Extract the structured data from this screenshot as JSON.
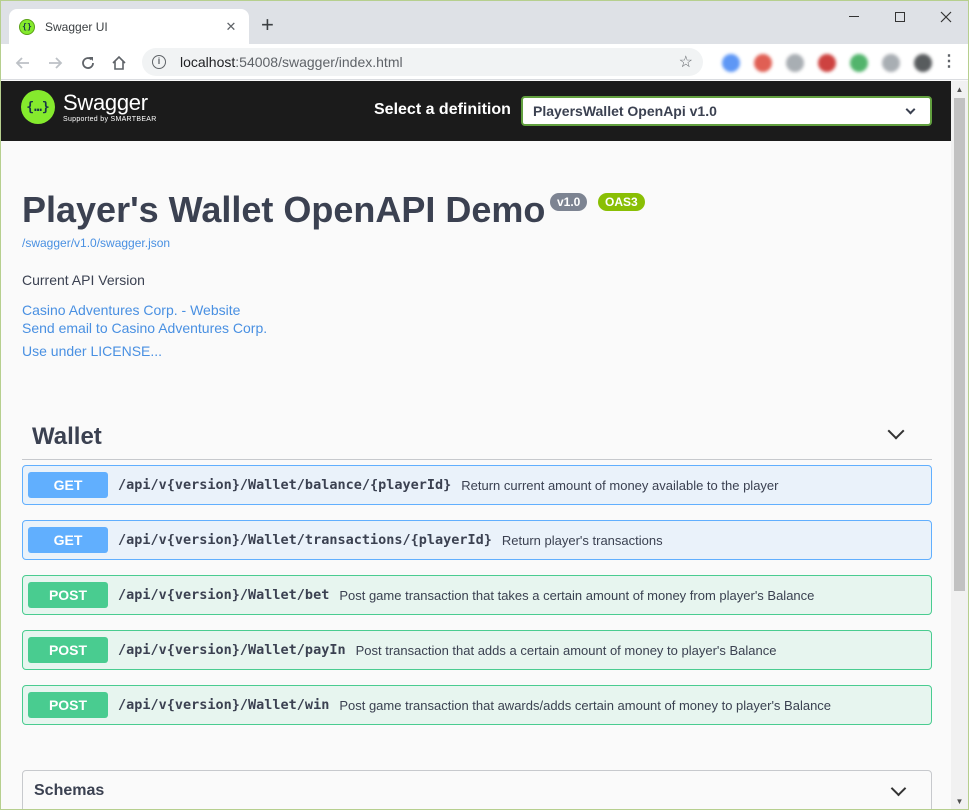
{
  "browser": {
    "tab_title": "Swagger UI",
    "tab_close": "✕",
    "new_tab": "+",
    "url_host": "localhost",
    "url_rest": ":54008/swagger/index.html",
    "extensions": [
      "#4285f4",
      "#db4437",
      "#9aa0a6",
      "#c5221f",
      "#34a853",
      "#9aa0a6",
      "#3c4043"
    ]
  },
  "swagger": {
    "brand": "Swagger",
    "brand_sub": "Supported by SMARTBEAR",
    "logo_glyph": "{…}",
    "definition_label": "Select a definition",
    "definition_value": "PlayersWallet OpenApi v1.0"
  },
  "info": {
    "title": "Player's Wallet OpenAPI Demo",
    "version_badge": "v1.0",
    "oas_badge": "OAS3",
    "spec_url": "/swagger/v1.0/swagger.json",
    "description": "Current API Version",
    "website_link": "Casino Adventures Corp. - Website",
    "email_link": "Send email to Casino Adventures Corp.",
    "license_link": "Use under LICENSE..."
  },
  "tag": {
    "name": "Wallet"
  },
  "operations": [
    {
      "method": "GET",
      "path": "/api/v{version}/Wallet/balance/{playerId}",
      "summary": "Return current amount of money available to the player"
    },
    {
      "method": "GET",
      "path": "/api/v{version}/Wallet/transactions/{playerId}",
      "summary": "Return player's transactions"
    },
    {
      "method": "POST",
      "path": "/api/v{version}/Wallet/bet",
      "summary": "Post game transaction that takes a certain amount of money from player's Balance"
    },
    {
      "method": "POST",
      "path": "/api/v{version}/Wallet/payIn",
      "summary": "Post transaction that adds a certain amount of money to player's Balance"
    },
    {
      "method": "POST",
      "path": "/api/v{version}/Wallet/win",
      "summary": "Post game transaction that awards/adds certain amount of money to player's Balance"
    }
  ],
  "schemas": {
    "title": "Schemas"
  }
}
